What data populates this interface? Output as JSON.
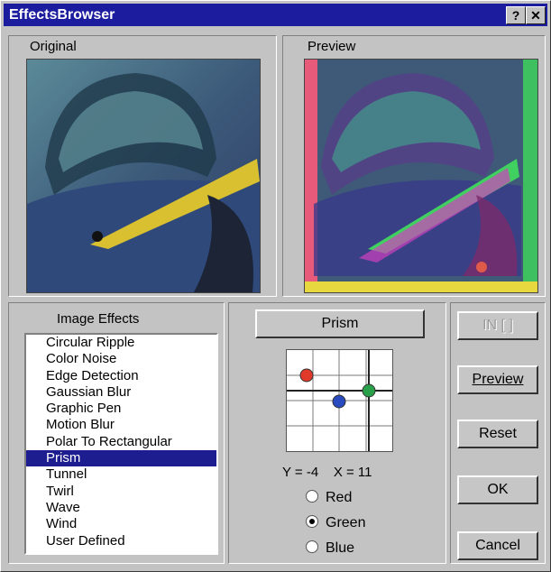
{
  "window": {
    "title": "EffectsBrowser",
    "help_label": "?",
    "close_label": "✕"
  },
  "original": {
    "label": "Original"
  },
  "preview": {
    "label": "Preview"
  },
  "effects": {
    "label": "Image Effects",
    "items": [
      "Circular Ripple",
      "Color Noise",
      "Edge Detection",
      "Gaussian Blur",
      "Graphic Pen",
      "Motion Blur",
      "Polar To Rectangular",
      "Prism",
      "Tunnel",
      "Twirl",
      "Wave",
      "Wind",
      "User Defined"
    ],
    "selected": "Prism"
  },
  "effect_button": {
    "label": "Prism"
  },
  "coords": {
    "text": "Y = -4    X = 11"
  },
  "channels": [
    {
      "label": "Red",
      "checked": false
    },
    {
      "label": "Green",
      "checked": true
    },
    {
      "label": "Blue",
      "checked": false
    }
  ],
  "buttons": {
    "in_label": "IN  [ ]",
    "preview": "Preview",
    "reset": "Reset",
    "ok": "OK",
    "cancel": "Cancel"
  },
  "colors": {
    "title_bar": "#1c1c9e",
    "selection": "#1d1d8f",
    "red_dot": "#e03a2a",
    "green_dot": "#2aa04a",
    "blue_dot": "#2a4ac0"
  }
}
